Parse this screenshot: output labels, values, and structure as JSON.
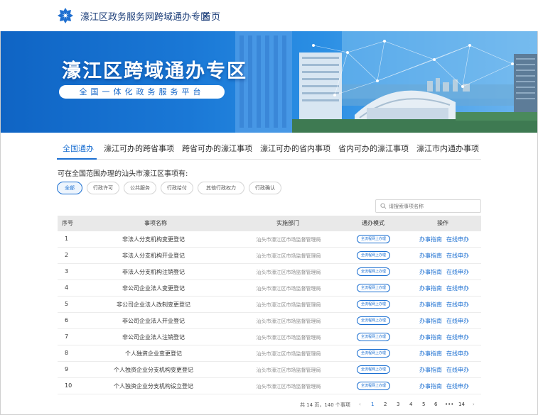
{
  "header": {
    "site_title": "濠江区政务服务网跨域通办专区",
    "home_link": "首页",
    "brand_color": "#1b6fd1",
    "logo_icon": "snowflake-logo"
  },
  "banner": {
    "title": "濠江区跨域通办专区",
    "subtitle": "全国一体化政务服务平台"
  },
  "tabs": [
    {
      "label": "全国通办",
      "active": true
    },
    {
      "label": "濠江可办的跨省事项",
      "active": false
    },
    {
      "label": "跨省可办的濠江事项",
      "active": false
    },
    {
      "label": "濠江可办的省内事项",
      "active": false
    },
    {
      "label": "省内可办的濠江事项",
      "active": false
    },
    {
      "label": "濠江市内通办事项",
      "active": false
    }
  ],
  "hint_text": "可在全国范围办理的汕头市濠江区事项有:",
  "filters": [
    {
      "label": "全部",
      "active": true
    },
    {
      "label": "行政许可",
      "active": false
    },
    {
      "label": "公共服务",
      "active": false
    },
    {
      "label": "行政给付",
      "active": false
    },
    {
      "label": "其他行政权力",
      "active": false
    },
    {
      "label": "行政确认",
      "active": false
    }
  ],
  "search": {
    "placeholder": "请搜索事项名称",
    "icon": "search-icon"
  },
  "table": {
    "columns": [
      "序号",
      "事项名称",
      "实施部门",
      "通办模式",
      "操作"
    ],
    "rows": [
      {
        "num": "1",
        "name": "非法人分支机构变更登记",
        "dept": "汕头市濠江区市场监督管理局",
        "mode": "全流程网上办理",
        "guide": "办事指南",
        "apply": "在线申办"
      },
      {
        "num": "2",
        "name": "非法人分支机构开业登记",
        "dept": "汕头市濠江区市场监督管理局",
        "mode": "全流程网上办理",
        "guide": "办事指南",
        "apply": "在线申办"
      },
      {
        "num": "3",
        "name": "非法人分支机构注销登记",
        "dept": "汕头市濠江区市场监督管理局",
        "mode": "全流程网上办理",
        "guide": "办事指南",
        "apply": "在线申办"
      },
      {
        "num": "4",
        "name": "非公司企业法人变更登记",
        "dept": "汕头市濠江区市场监督管理局",
        "mode": "全流程网上办理",
        "guide": "办事指南",
        "apply": "在线申办"
      },
      {
        "num": "5",
        "name": "非公司企业法人改制变更登记",
        "dept": "汕头市濠江区市场监督管理局",
        "mode": "全流程网上办理",
        "guide": "办事指南",
        "apply": "在线申办"
      },
      {
        "num": "6",
        "name": "非公司企业法人开业登记",
        "dept": "汕头市濠江区市场监督管理局",
        "mode": "全流程网上办理",
        "guide": "办事指南",
        "apply": "在线申办"
      },
      {
        "num": "7",
        "name": "非公司企业法人注销登记",
        "dept": "汕头市濠江区市场监督管理局",
        "mode": "全流程网上办理",
        "guide": "办事指南",
        "apply": "在线申办"
      },
      {
        "num": "8",
        "name": "个人独资企业变更登记",
        "dept": "汕头市濠江区市场监督管理局",
        "mode": "全流程网上办理",
        "guide": "办事指南",
        "apply": "在线申办"
      },
      {
        "num": "9",
        "name": "个人独资企业分支机构变更登记",
        "dept": "汕头市濠江区市场监督管理局",
        "mode": "全流程网上办理",
        "guide": "办事指南",
        "apply": "在线申办"
      },
      {
        "num": "10",
        "name": "个人独资企业分支机构设立登记",
        "dept": "汕头市濠江区市场监督管理局",
        "mode": "全流程网上办理",
        "guide": "办事指南",
        "apply": "在线申办"
      }
    ]
  },
  "pagination": {
    "total_text": "共 14 页，140 个事项",
    "prev": "‹",
    "pages": [
      "1",
      "2",
      "3",
      "4",
      "5",
      "6",
      "•••",
      "14"
    ],
    "current": "1",
    "next": "›"
  }
}
